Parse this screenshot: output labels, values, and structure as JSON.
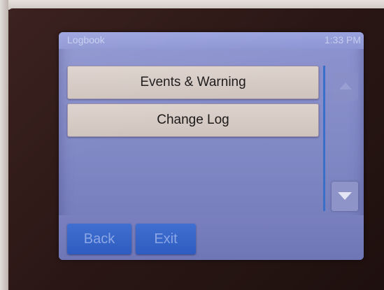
{
  "header": {
    "title": "Logbook",
    "clock": "1:33 PM"
  },
  "menu": {
    "items": [
      {
        "label": "Events & Warning"
      },
      {
        "label": "Change Log"
      }
    ]
  },
  "scroll": {
    "up_icon": "arrow-up-icon",
    "down_icon": "arrow-down-icon"
  },
  "footer": {
    "back_label": "Back",
    "exit_label": "Exit"
  },
  "colors": {
    "screen_background": "#8088c4",
    "menu_button": "#ddd2cc",
    "nav_button": "#3f6fd0",
    "scroll_divider": "#3a6fc9"
  }
}
